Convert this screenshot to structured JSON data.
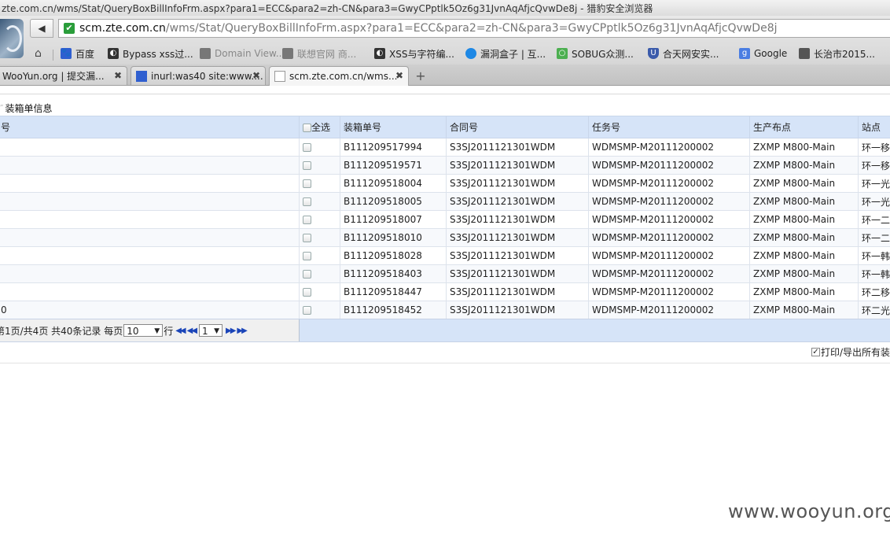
{
  "window": {
    "title": "zte.com.cn/wms/Stat/QueryBoxBillInfoFrm.aspx?para1=ECC&para2=zh-CN&para3=GwyCPptlk5Oz6g31JvnAqAfjcQvwDe8j - 猎豹安全浏览器"
  },
  "address_bar": {
    "host": "scm.zte.com.cn",
    "path": "/wms/Stat/QueryBoxBillInfoFrm.aspx?para1=ECC&para2=zh-CN&para3=GwyCPptlk5Oz6g31JvnAqAfjcQvwDe8j"
  },
  "bookmarks": [
    {
      "label": "百度",
      "icon": "baidu-paw-icon",
      "color": "#2f5fd0"
    },
    {
      "label": "Bypass xss过...",
      "icon": "globe-icon",
      "color": "#333333"
    },
    {
      "label": "Domain View...",
      "icon": "page-icon",
      "color": "#777777"
    },
    {
      "label": "联想官网 商...",
      "icon": "page-icon",
      "color": "#777777"
    },
    {
      "label": "XSS与字符编...",
      "icon": "globe-icon",
      "color": "#333333"
    },
    {
      "label": "漏洞盒子 | 互...",
      "icon": "shield-icon",
      "color": "#1e88e5"
    },
    {
      "label": "SOBUG众测...",
      "icon": "sobug-icon",
      "color": "#4caf50"
    },
    {
      "label": "合天网安实...",
      "icon": "shield-icon",
      "color": "#3b5bab"
    },
    {
      "label": "Google",
      "icon": "google-icon",
      "color": "#4a7de2"
    },
    {
      "label": "长治市2015...",
      "icon": "folder-icon",
      "color": "#555555"
    }
  ],
  "tabs": [
    {
      "label": "WooYun.org | 提交漏...",
      "active": false
    },
    {
      "label": "inurl:was40 site:www....",
      "active": false
    },
    {
      "label": "scm.zte.com.cn/wms...",
      "active": true
    }
  ],
  "page": {
    "section_title": "装箱单信息",
    "columns": {
      "partial_first": "号",
      "select_all": "全选",
      "box_no": "装箱单号",
      "contract_no": "合同号",
      "task_no": "任务号",
      "layout": "生产布点",
      "site": "站点"
    },
    "rows": [
      {
        "first": "",
        "box_no": "B111209517994",
        "contract_no": "S3SJ2011121301WDM",
        "task_no": "WDMSMP-M20111200002",
        "layout": "ZXMP M800-Main",
        "site": "环一移"
      },
      {
        "first": "",
        "box_no": "B111209519571",
        "contract_no": "S3SJ2011121301WDM",
        "task_no": "WDMSMP-M20111200002",
        "layout": "ZXMP M800-Main",
        "site": "环一移"
      },
      {
        "first": "",
        "box_no": "B111209518004",
        "contract_no": "S3SJ2011121301WDM",
        "task_no": "WDMSMP-M20111200002",
        "layout": "ZXMP M800-Main",
        "site": "环一光"
      },
      {
        "first": "",
        "box_no": "B111209518005",
        "contract_no": "S3SJ2011121301WDM",
        "task_no": "WDMSMP-M20111200002",
        "layout": "ZXMP M800-Main",
        "site": "环一光"
      },
      {
        "first": "",
        "box_no": "B111209518007",
        "contract_no": "S3SJ2011121301WDM",
        "task_no": "WDMSMP-M20111200002",
        "layout": "ZXMP M800-Main",
        "site": "环一二"
      },
      {
        "first": "",
        "box_no": "B111209518010",
        "contract_no": "S3SJ2011121301WDM",
        "task_no": "WDMSMP-M20111200002",
        "layout": "ZXMP M800-Main",
        "site": "环一二"
      },
      {
        "first": "",
        "box_no": "B111209518028",
        "contract_no": "S3SJ2011121301WDM",
        "task_no": "WDMSMP-M20111200002",
        "layout": "ZXMP M800-Main",
        "site": "环一韩"
      },
      {
        "first": "",
        "box_no": "B111209518403",
        "contract_no": "S3SJ2011121301WDM",
        "task_no": "WDMSMP-M20111200002",
        "layout": "ZXMP M800-Main",
        "site": "环一韩"
      },
      {
        "first": "",
        "box_no": "B111209518447",
        "contract_no": "S3SJ2011121301WDM",
        "task_no": "WDMSMP-M20111200002",
        "layout": "ZXMP M800-Main",
        "site": "环二移"
      },
      {
        "first": "0",
        "box_no": "B111209518452",
        "contract_no": "S3SJ2011121301WDM",
        "task_no": "WDMSMP-M20111200002",
        "layout": "ZXMP M800-Main",
        "site": "环二光"
      }
    ],
    "pager": {
      "status_text": "第1页/共4页 共40条记录 每页",
      "page_size": "10",
      "rows_suffix": "行",
      "page_number": "1"
    },
    "print_option": {
      "label": "打印/导出所有装",
      "checked": true
    }
  },
  "watermark": "www.wooyun.org"
}
